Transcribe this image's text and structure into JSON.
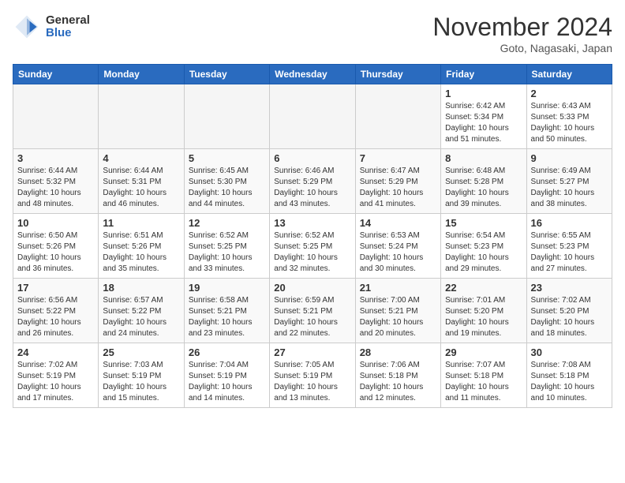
{
  "header": {
    "logo_general": "General",
    "logo_blue": "Blue",
    "month_title": "November 2024",
    "location": "Goto, Nagasaki, Japan"
  },
  "weekdays": [
    "Sunday",
    "Monday",
    "Tuesday",
    "Wednesday",
    "Thursday",
    "Friday",
    "Saturday"
  ],
  "weeks": [
    [
      {
        "day": "",
        "empty": true
      },
      {
        "day": "",
        "empty": true
      },
      {
        "day": "",
        "empty": true
      },
      {
        "day": "",
        "empty": true
      },
      {
        "day": "",
        "empty": true
      },
      {
        "day": "1",
        "sunrise": "6:42 AM",
        "sunset": "5:34 PM",
        "daylight": "10 hours and 51 minutes."
      },
      {
        "day": "2",
        "sunrise": "6:43 AM",
        "sunset": "5:33 PM",
        "daylight": "10 hours and 50 minutes."
      }
    ],
    [
      {
        "day": "3",
        "sunrise": "6:44 AM",
        "sunset": "5:32 PM",
        "daylight": "10 hours and 48 minutes."
      },
      {
        "day": "4",
        "sunrise": "6:44 AM",
        "sunset": "5:31 PM",
        "daylight": "10 hours and 46 minutes."
      },
      {
        "day": "5",
        "sunrise": "6:45 AM",
        "sunset": "5:30 PM",
        "daylight": "10 hours and 44 minutes."
      },
      {
        "day": "6",
        "sunrise": "6:46 AM",
        "sunset": "5:29 PM",
        "daylight": "10 hours and 43 minutes."
      },
      {
        "day": "7",
        "sunrise": "6:47 AM",
        "sunset": "5:29 PM",
        "daylight": "10 hours and 41 minutes."
      },
      {
        "day": "8",
        "sunrise": "6:48 AM",
        "sunset": "5:28 PM",
        "daylight": "10 hours and 39 minutes."
      },
      {
        "day": "9",
        "sunrise": "6:49 AM",
        "sunset": "5:27 PM",
        "daylight": "10 hours and 38 minutes."
      }
    ],
    [
      {
        "day": "10",
        "sunrise": "6:50 AM",
        "sunset": "5:26 PM",
        "daylight": "10 hours and 36 minutes."
      },
      {
        "day": "11",
        "sunrise": "6:51 AM",
        "sunset": "5:26 PM",
        "daylight": "10 hours and 35 minutes."
      },
      {
        "day": "12",
        "sunrise": "6:52 AM",
        "sunset": "5:25 PM",
        "daylight": "10 hours and 33 minutes."
      },
      {
        "day": "13",
        "sunrise": "6:52 AM",
        "sunset": "5:25 PM",
        "daylight": "10 hours and 32 minutes."
      },
      {
        "day": "14",
        "sunrise": "6:53 AM",
        "sunset": "5:24 PM",
        "daylight": "10 hours and 30 minutes."
      },
      {
        "day": "15",
        "sunrise": "6:54 AM",
        "sunset": "5:23 PM",
        "daylight": "10 hours and 29 minutes."
      },
      {
        "day": "16",
        "sunrise": "6:55 AM",
        "sunset": "5:23 PM",
        "daylight": "10 hours and 27 minutes."
      }
    ],
    [
      {
        "day": "17",
        "sunrise": "6:56 AM",
        "sunset": "5:22 PM",
        "daylight": "10 hours and 26 minutes."
      },
      {
        "day": "18",
        "sunrise": "6:57 AM",
        "sunset": "5:22 PM",
        "daylight": "10 hours and 24 minutes."
      },
      {
        "day": "19",
        "sunrise": "6:58 AM",
        "sunset": "5:21 PM",
        "daylight": "10 hours and 23 minutes."
      },
      {
        "day": "20",
        "sunrise": "6:59 AM",
        "sunset": "5:21 PM",
        "daylight": "10 hours and 22 minutes."
      },
      {
        "day": "21",
        "sunrise": "7:00 AM",
        "sunset": "5:21 PM",
        "daylight": "10 hours and 20 minutes."
      },
      {
        "day": "22",
        "sunrise": "7:01 AM",
        "sunset": "5:20 PM",
        "daylight": "10 hours and 19 minutes."
      },
      {
        "day": "23",
        "sunrise": "7:02 AM",
        "sunset": "5:20 PM",
        "daylight": "10 hours and 18 minutes."
      }
    ],
    [
      {
        "day": "24",
        "sunrise": "7:02 AM",
        "sunset": "5:19 PM",
        "daylight": "10 hours and 17 minutes."
      },
      {
        "day": "25",
        "sunrise": "7:03 AM",
        "sunset": "5:19 PM",
        "daylight": "10 hours and 15 minutes."
      },
      {
        "day": "26",
        "sunrise": "7:04 AM",
        "sunset": "5:19 PM",
        "daylight": "10 hours and 14 minutes."
      },
      {
        "day": "27",
        "sunrise": "7:05 AM",
        "sunset": "5:19 PM",
        "daylight": "10 hours and 13 minutes."
      },
      {
        "day": "28",
        "sunrise": "7:06 AM",
        "sunset": "5:18 PM",
        "daylight": "10 hours and 12 minutes."
      },
      {
        "day": "29",
        "sunrise": "7:07 AM",
        "sunset": "5:18 PM",
        "daylight": "10 hours and 11 minutes."
      },
      {
        "day": "30",
        "sunrise": "7:08 AM",
        "sunset": "5:18 PM",
        "daylight": "10 hours and 10 minutes."
      }
    ]
  ]
}
